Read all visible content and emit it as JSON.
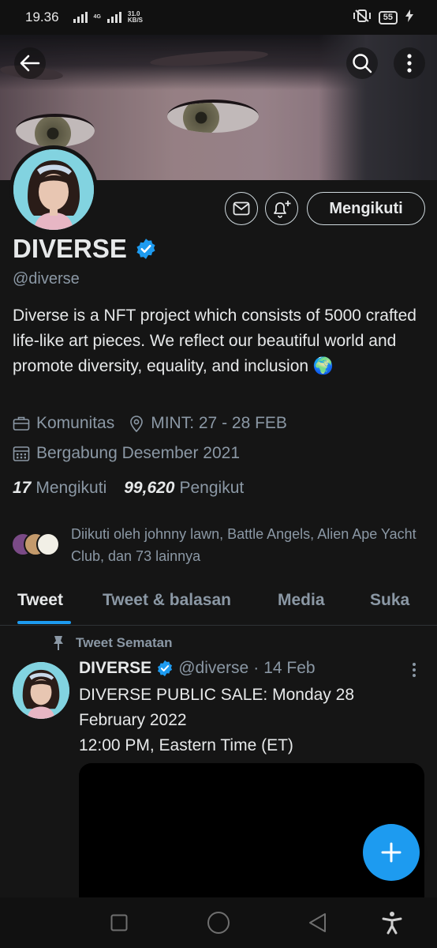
{
  "status_bar": {
    "time": "19.36",
    "network": "4G",
    "speed_value": "31.0",
    "speed_unit": "KB/S",
    "battery": "55"
  },
  "profile": {
    "name": "DIVERSE",
    "handle": "@diverse",
    "follow_button": "Mengikuti",
    "bio": "Diverse is a NFT project which consists of 5000 crafted life-like art pieces. We reflect our beautiful world and promote diversity, equality, and inclusion 🌍",
    "category": "Komunitas",
    "location": "MINT: 27 - 28 FEB",
    "joined": "Bergabung Desember 2021",
    "following_count": "17",
    "following_label": "Mengikuti",
    "followers_count": "99,620",
    "followers_label": "Pengikut",
    "followed_by": "Diikuti oleh johnny lawn, Battle Angels, Alien Ape Yacht Club, dan 73 lainnya"
  },
  "tabs": [
    {
      "label": "Tweet",
      "active": true
    },
    {
      "label": "Tweet & balasan",
      "active": false
    },
    {
      "label": "Media",
      "active": false
    },
    {
      "label": "Suka",
      "active": false
    }
  ],
  "pinned_tweet": {
    "pinned_label": "Tweet Sematan",
    "author_name": "DIVERSE",
    "author_handle": "@diverse",
    "separator": "·",
    "date": "14 Feb",
    "text_line1": "DIVERSE PUBLIC SALE: Monday 28 February 2022",
    "text_line2": "12:00 PM, Eastern Time (ET)"
  },
  "colors": {
    "accent": "#1d9bf0",
    "background": "#151515",
    "secondary_text": "#8b98a5"
  },
  "icons": {
    "back": "arrow-left-icon",
    "search": "search-icon",
    "more": "more-vertical-icon",
    "message": "envelope-icon",
    "notify": "bell-plus-icon",
    "verified": "verified-badge-icon",
    "category": "briefcase-icon",
    "location": "location-pin-icon",
    "calendar": "calendar-icon",
    "pin": "pin-icon",
    "compose": "plus-icon"
  }
}
